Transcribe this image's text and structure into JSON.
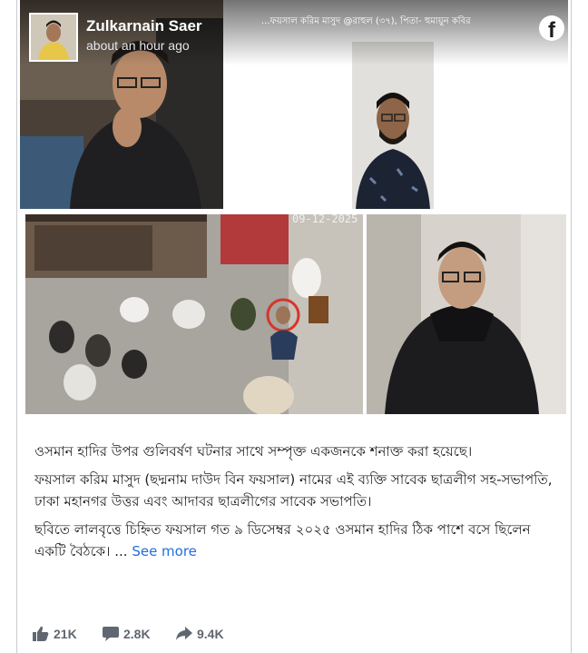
{
  "post": {
    "author": "Zulkarnain Saer",
    "timestamp": "about an hour ago",
    "header_caption": "...ফয়সাল করিম মাসুদ @রাহুল (৩৭), পিতা- হুমায়ুন কবির",
    "cctv_timestamp": "09-12-2025",
    "brand_icon": "facebook-icon",
    "paragraphs": [
      "ওসমান হাদির উপর গুলিবর্ষণ ঘটনার সাথে সম্পৃক্ত একজনকে শনাক্ত করা হয়েছে।",
      "ফয়সাল করিম মাসুদ (ছদ্মনাম দাউদ বিন ফয়সাল) নামের এই ব্যক্তি সাবেক ছাত্রলীগ সহ-সভাপতি, ঢাকা মহানগর উত্তর এবং আদাবর ছাত্রলীগের সাবেক সভাপতি।",
      "ছবিতে লালবৃত্তে চিহ্নিত ফয়সাল গত ৯ ডিসেম্বর ২০২৫ ওসমান হাদির ঠিক পাশে বসে ছিলেন একটি বৈঠকে। ..."
    ],
    "see_more": "See more"
  },
  "stats": {
    "likes": "21K",
    "comments": "2.8K",
    "shares": "9.4K"
  },
  "colors": {
    "link": "#216fdb",
    "text": "#1c1e21",
    "stat": "#606770",
    "highlight_circle": "#d8342a"
  }
}
